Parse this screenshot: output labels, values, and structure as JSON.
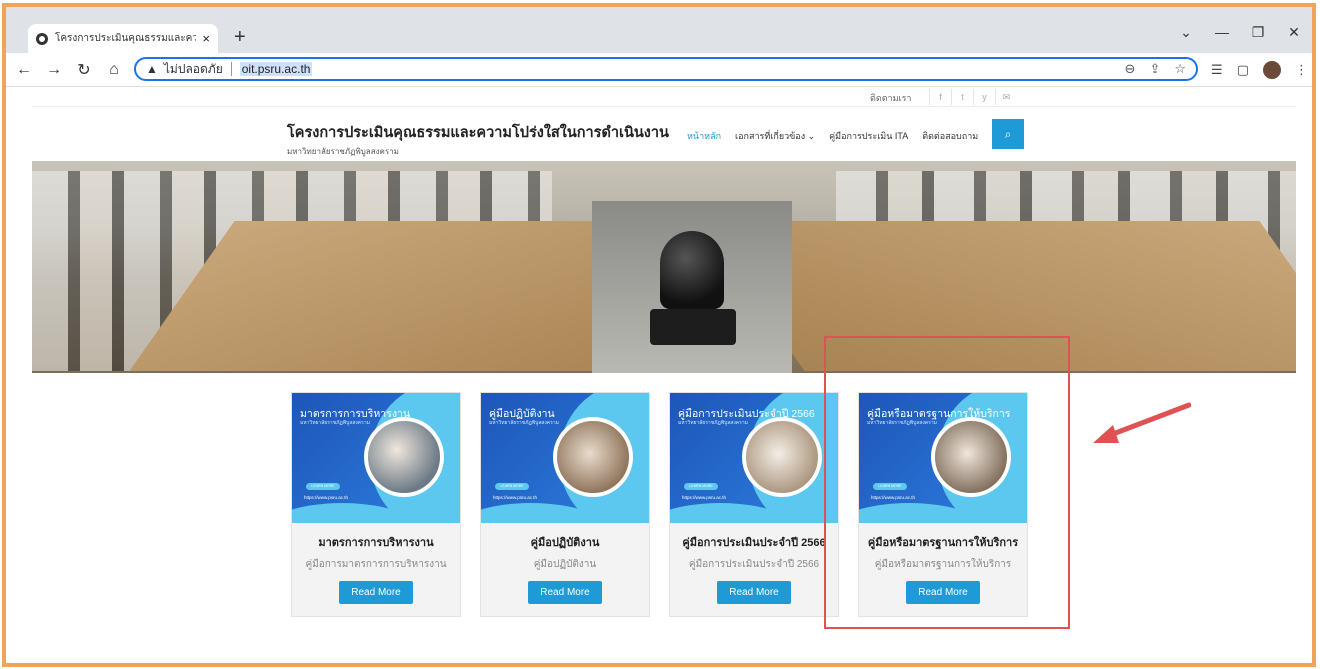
{
  "browser": {
    "tab_title": "โครงการประเมินคุณธรรมและความโปร่ง",
    "tab_close": "×",
    "new_tab": "+",
    "window_controls": [
      "⌄",
      "—",
      "❐",
      "✕"
    ],
    "nav": {
      "back": "←",
      "forward": "→",
      "reload": "↻",
      "home": "⌂"
    },
    "security_label": "ไม่ปลอดภัย",
    "url": "oit.psru.ac.th",
    "omnibox_icons": [
      "zoom-icon",
      "share-icon",
      "star-icon"
    ],
    "extension_icons": [
      "reading-list-icon",
      "side-panel-icon",
      "profile-avatar",
      "menu-icon"
    ]
  },
  "site": {
    "topbar": {
      "contact": "ติดตามเรา",
      "social": [
        "f",
        "t",
        "y",
        "✉"
      ]
    },
    "brand": {
      "title": "โครงการประเมินคุณธรรมและความโปร่งใสในการดำเนินงาน",
      "subtitle": "มหาวิทยาลัยราชภัฏพิบูลสงคราม"
    },
    "menu": [
      {
        "label": "หน้าหลัก",
        "active": true
      },
      {
        "label": "เอกสารที่เกี่ยวข้อง ⌄",
        "active": false
      },
      {
        "label": "คู่มือการประเมิน ITA",
        "active": false
      },
      {
        "label": "ติดต่อสอบถาม",
        "active": false
      }
    ],
    "search_icon": "⌕"
  },
  "cards": [
    {
      "thumb_title": "มาตรการการบริหารงาน",
      "thumb_sub": "มหาวิทยาลัยราชภัฏพิบูลสงคราม",
      "thumb_btn": "LEARN MORE",
      "thumb_link": "https://www.psru.ac.th",
      "heading": "มาตรการการบริหารงาน",
      "desc": "คู่มือการมาตรการการบริหารงาน",
      "button": "Read More",
      "photo": "speaker-photo"
    },
    {
      "thumb_title": "คู่มือปฏิบัติงาน",
      "thumb_sub": "มหาวิทยาลัยราชภัฏพิบูลสงคราม",
      "thumb_btn": "LEARN MORE",
      "thumb_link": "https://www.psru.ac.th",
      "heading": "คู่มือปฏิบัติงาน",
      "desc": "คู่มือปฏิบัติงาน",
      "button": "Read More",
      "photo": "book-photo"
    },
    {
      "thumb_title": "คู่มือการประเมินประจำปี 2566",
      "thumb_sub": "มหาวิทยาลัยราชภัฏพิบูลสงคราม",
      "thumb_btn": "LEARN MORE",
      "thumb_link": "https://www.psru.ac.th",
      "heading": "คู่มือการประเมินประจำปี 2566",
      "desc": "คู่มือการประเมินประจำปี 2566",
      "button": "Read More",
      "photo": "document-photo"
    },
    {
      "thumb_title": "คู่มือหรือมาตรฐานการให้บริการ",
      "thumb_sub": "มหาวิทยาลัยราชภัฏพิบูลสงคราม",
      "thumb_btn": "LEARN MORE",
      "thumb_link": "https://www.psru.ac.th",
      "heading": "คู่มือหรือมาตรฐานการให้บริการ",
      "desc": "คู่มือหรือมาตรฐานการให้บริการ",
      "button": "Read More",
      "photo": "writing-photo"
    }
  ],
  "colors": {
    "accent": "#1e9ad6",
    "frame": "#f0a35a",
    "highlight": "#e05252",
    "card_blue": "#1d56b8",
    "card_cyan": "#5cc7ef"
  }
}
